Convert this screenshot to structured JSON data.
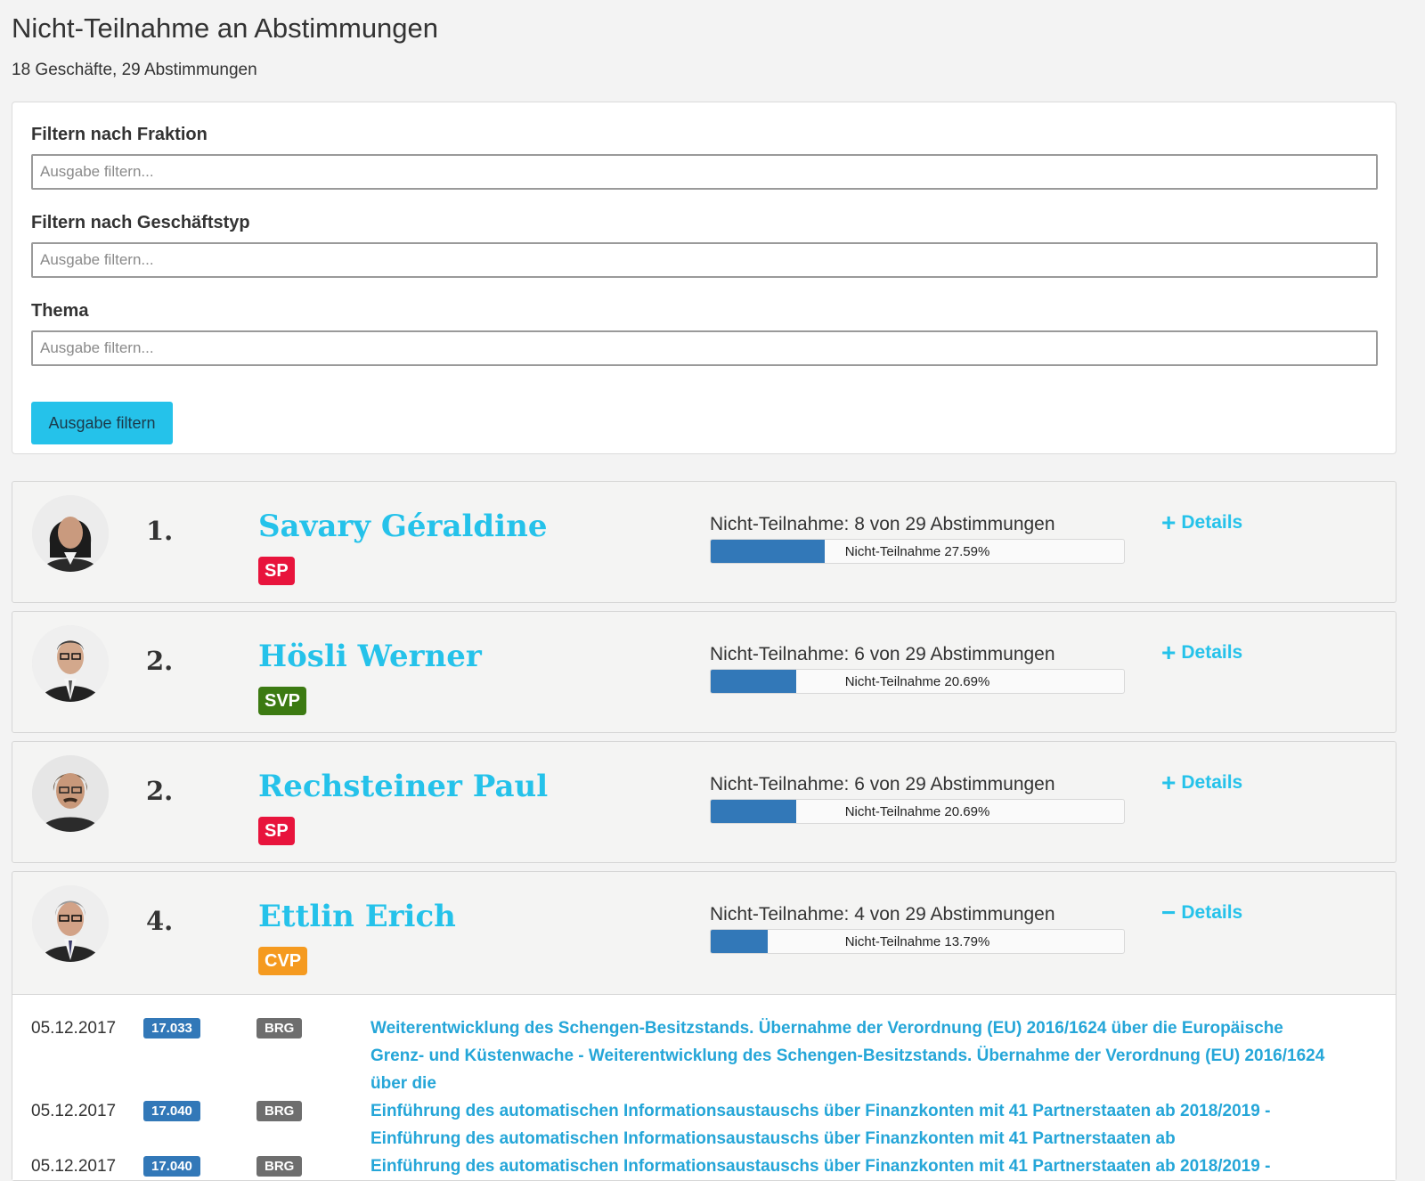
{
  "page": {
    "title": "Nicht-Teilnahme an Abstimmungen",
    "subtitle": "18 Geschäfte, 29 Abstimmungen"
  },
  "filters": {
    "fraktion": {
      "label": "Filtern nach Fraktion",
      "placeholder": "Ausgabe filtern..."
    },
    "geschaeftstyp": {
      "label": "Filtern nach Geschäftstyp",
      "placeholder": "Ausgabe filtern..."
    },
    "thema": {
      "label": "Thema",
      "placeholder": "Ausgabe filtern..."
    },
    "button_label": "Ausgabe filtern"
  },
  "colors": {
    "accent": "#25c2ea",
    "bar": "#3278b8",
    "SP": "#e8143c",
    "SVP": "#3c7a12",
    "CVP": "#f59a1f"
  },
  "members": [
    {
      "rank": "1.",
      "name": "Savary Géraldine",
      "party": "SP",
      "party_color": "#e8143c",
      "stat": "Nicht-Teilnahme: 8 von 29 Abstimmungen",
      "bar_label": "Nicht-Teilnahme 27.59%",
      "percent": 27.59,
      "details_sign": "+",
      "details_label": "Details"
    },
    {
      "rank": "2.",
      "name": "Hösli Werner",
      "party": "SVP",
      "party_color": "#3c7a12",
      "stat": "Nicht-Teilnahme: 6 von 29 Abstimmungen",
      "bar_label": "Nicht-Teilnahme 20.69%",
      "percent": 20.69,
      "details_sign": "+",
      "details_label": "Details"
    },
    {
      "rank": "2.",
      "name": "Rechsteiner Paul",
      "party": "SP",
      "party_color": "#e8143c",
      "stat": "Nicht-Teilnahme: 6 von 29 Abstimmungen",
      "bar_label": "Nicht-Teilnahme 20.69%",
      "percent": 20.69,
      "details_sign": "+",
      "details_label": "Details"
    },
    {
      "rank": "4.",
      "name": "Ettlin Erich",
      "party": "CVP",
      "party_color": "#f59a1f",
      "stat": "Nicht-Teilnahme: 4 von 29 Abstimmungen",
      "bar_label": "Nicht-Teilnahme 13.79%",
      "percent": 13.79,
      "details_sign": "−",
      "details_label": "Details"
    }
  ],
  "details_rows": [
    {
      "date": "05.12.2017",
      "number": "17.033",
      "type": "BRG",
      "title": "Weiterentwicklung des Schengen-Besitzstands. Übernahme der Verordnung (EU) 2016/1624 über die Europäische Grenz- und Küstenwache - Weiterentwicklung des Schengen-Besitzstands. Übernahme der Verordnung (EU) 2016/1624 über die"
    },
    {
      "date": "05.12.2017",
      "number": "17.040",
      "type": "BRG",
      "title": "Einführung des automatischen Informationsaustauschs über Finanzkonten mit 41 Partnerstaaten ab 2018/2019 - Einführung des automatischen Informationsaustauschs über Finanzkonten mit 41 Partnerstaaten ab"
    },
    {
      "date": "05.12.2017",
      "number": "17.040",
      "type": "BRG",
      "title": "Einführung des automatischen Informationsaustauschs über Finanzkonten mit 41 Partnerstaaten ab 2018/2019 -"
    }
  ]
}
